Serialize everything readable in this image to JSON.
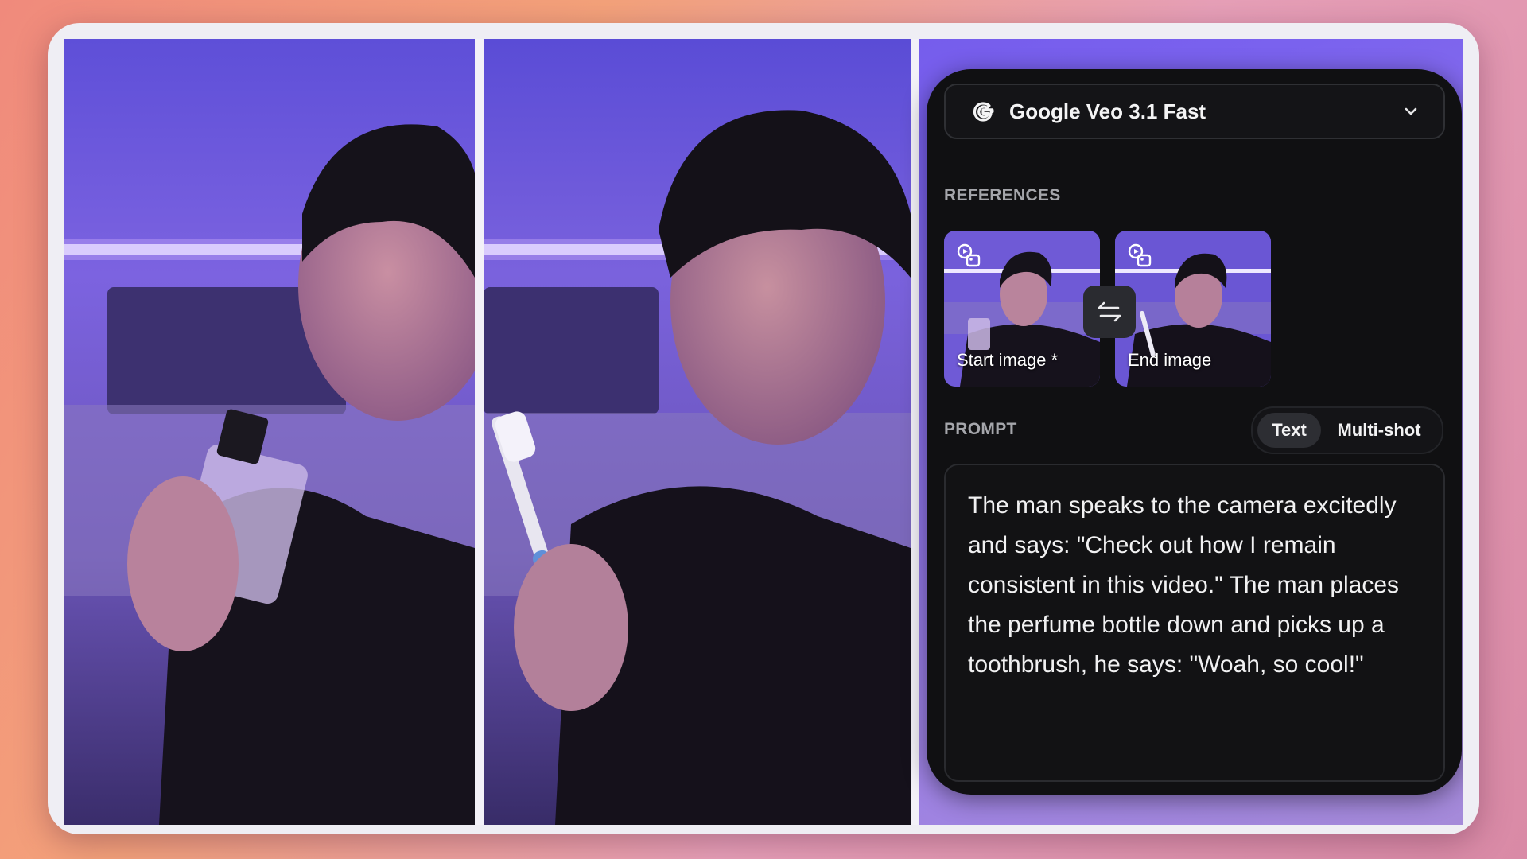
{
  "model_select": {
    "name": "Google Veo 3.1 Fast",
    "icon": "google-g-icon"
  },
  "references": {
    "label": "REFERENCES",
    "start_caption": "Start image *",
    "end_caption": "End image"
  },
  "prompt": {
    "label": "PROMPT",
    "modes": {
      "text": "Text",
      "multi": "Multi-shot"
    },
    "selected_mode": "Text",
    "value": "The man speaks to the camera excitedly and says: \"Check out how I remain consistent in this video.\" The man places the perfume bottle down and picks up a toothbrush, he says: \"Woah, so cool!\""
  },
  "colors": {
    "panel": "#101012",
    "stage": "#7a62ee",
    "frame": "#efeef4"
  }
}
